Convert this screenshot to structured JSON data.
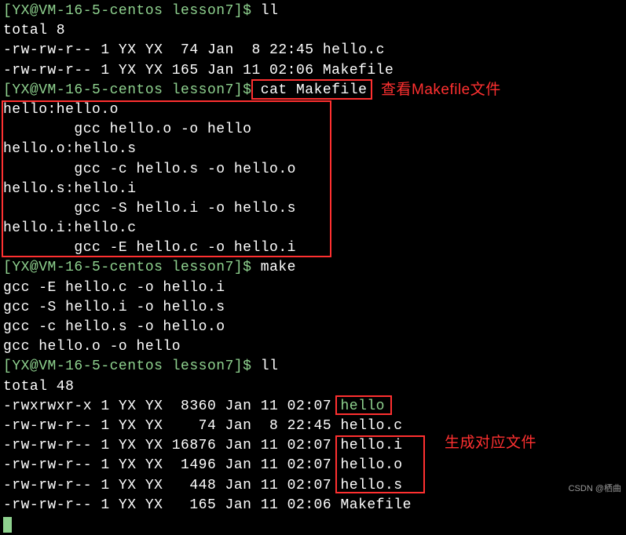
{
  "prompt": {
    "open": "[",
    "user_host": "YX@VM-16-5-centos",
    "dir": " lesson7",
    "close": "]$ "
  },
  "cmds": {
    "ll1": "ll",
    "cat": "cat Makefile",
    "make": "make",
    "ll2": "ll"
  },
  "out": {
    "total1": "total 8",
    "ls1_line1": "-rw-rw-r-- 1 YX YX  74 Jan  8 22:45 hello.c",
    "ls1_line2": "-rw-rw-r-- 1 YX YX 165 Jan 11 02:06 Makefile",
    "makefile": {
      "l1": "hello:hello.o",
      "l2": "        gcc hello.o -o hello",
      "l3": "hello.o:hello.s",
      "l4": "        gcc -c hello.s -o hello.o",
      "l5": "hello.s:hello.i",
      "l6": "        gcc -S hello.i -o hello.s",
      "l7": "hello.i:hello.c",
      "l8": "        gcc -E hello.c -o hello.i"
    },
    "make_out": {
      "l1": "gcc -E hello.c -o hello.i",
      "l2": "gcc -S hello.i -o hello.s",
      "l3": "gcc -c hello.s -o hello.o",
      "l4": "gcc hello.o -o hello"
    },
    "total2": "total 48",
    "ls2": {
      "r1p": "-rwxrwxr-x 1 YX YX  8360 Jan 11 02:07 ",
      "r1f": "hello",
      "r2": "-rw-rw-r-- 1 YX YX    74 Jan  8 22:45 hello.c",
      "r3": "-rw-rw-r-- 1 YX YX 16876 Jan 11 02:07 hello.i",
      "r4": "-rw-rw-r-- 1 YX YX  1496 Jan 11 02:07 hello.o",
      "r5": "-rw-rw-r-- 1 YX YX   448 Jan 11 02:07 hello.s",
      "r6": "-rw-rw-r-- 1 YX YX   165 Jan 11 02:06 Makefile"
    }
  },
  "annotations": {
    "label1": "查看Makefile文件",
    "label2": "生成对应文件"
  },
  "watermark": "CSDN @栖曲"
}
